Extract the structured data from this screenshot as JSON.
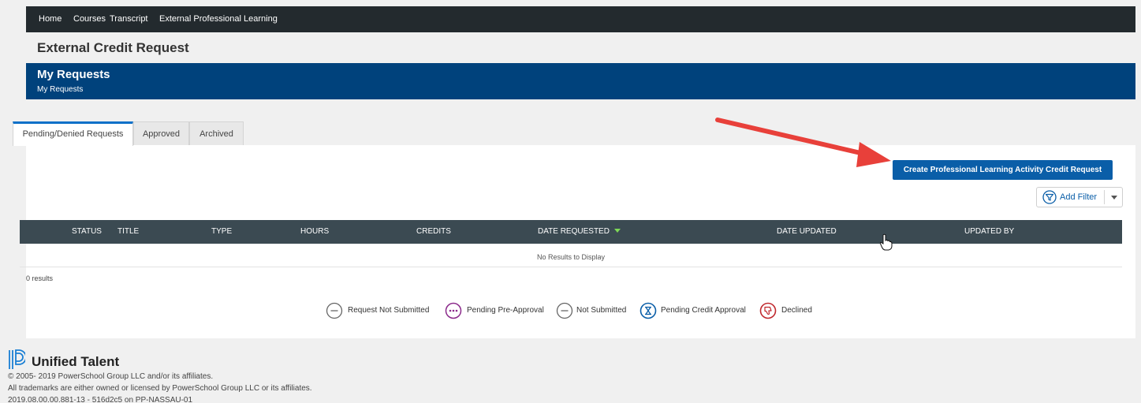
{
  "topnav": {
    "items": [
      "Home",
      "Courses",
      "Transcript",
      "External Professional Learning"
    ]
  },
  "page": {
    "title": "External Credit Request"
  },
  "banner": {
    "heading": "My Requests",
    "breadcrumb": "My Requests"
  },
  "tabs": [
    {
      "label": "Pending/Denied Requests",
      "active": true
    },
    {
      "label": "Approved",
      "active": false
    },
    {
      "label": "Archived",
      "active": false
    }
  ],
  "actions": {
    "create_label": "Create Professional Learning Activity Credit Request",
    "filter_label": "Add Filter"
  },
  "table": {
    "columns": [
      "STATUS",
      "TITLE",
      "TYPE",
      "HOURS",
      "CREDITS",
      "DATE REQUESTED",
      "DATE UPDATED",
      "UPDATED BY"
    ],
    "sorted_column": "DATE REQUESTED",
    "empty_text": "No Results to Display",
    "result_count": "0 results"
  },
  "legend": [
    {
      "icon": "minus-circle-icon",
      "label": "Request Not Submitted",
      "color": "#666666"
    },
    {
      "icon": "ellipsis-circle-icon",
      "label": "Pending Pre-Approval",
      "color": "#8b2a8b"
    },
    {
      "icon": "minus-circle-icon",
      "label": "Not Submitted",
      "color": "#666666"
    },
    {
      "icon": "hourglass-circle-icon",
      "label": "Pending Credit Approval",
      "color": "#0a5ea8"
    },
    {
      "icon": "thumbs-down-circle-icon",
      "label": "Declined",
      "color": "#c0282d"
    }
  ],
  "footer": {
    "brand": "Unified Talent",
    "copyright": "© 2005- 2019 PowerSchool Group LLC and/or its affiliates.",
    "trademark": "All trademarks are either owned or licensed by PowerSchool Group LLC or its affiliates.",
    "version": "2019.08.00.00.881-13 - 516d2c5 on PP-NASSAU-01"
  },
  "colors": {
    "nav": "#232a2e",
    "banner": "#00427c",
    "primary": "#0a5ea8",
    "table_header": "#3b4a52",
    "annotation_arrow": "#e8403a"
  }
}
